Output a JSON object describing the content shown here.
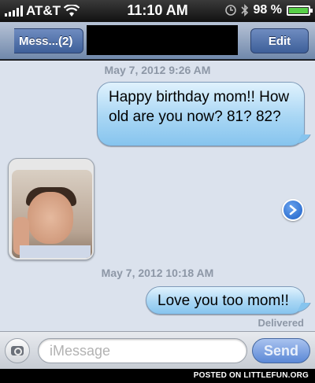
{
  "status_bar": {
    "carrier": "AT&T",
    "time": "11:10 AM",
    "battery_percent": "98 %",
    "battery_level": 0.98
  },
  "nav": {
    "back_label": "Mess...(2)",
    "edit_label": "Edit"
  },
  "messages": [
    {
      "type": "timestamp",
      "text": "May 7, 2012 9:26 AM"
    },
    {
      "type": "sent",
      "text": "Happy birthday mom!! How old are you now? 81? 82?"
    },
    {
      "type": "received_photo"
    },
    {
      "type": "timestamp",
      "text": "May 7, 2012 10:18 AM"
    },
    {
      "type": "sent",
      "text": "Love you too mom!!"
    }
  ],
  "delivered_label": "Delivered",
  "input": {
    "placeholder": "iMessage",
    "send_label": "Send"
  },
  "watermark": "POSTED ON LITTLEFUN.ORG",
  "colors": {
    "sent_bubble": "#a8d6f4",
    "background": "#dbe2ed",
    "nav_bar": "#7088ab"
  },
  "icons": [
    "wifi-icon",
    "clock-icon",
    "bluetooth-icon",
    "battery-icon",
    "camera-icon",
    "forward-icon"
  ]
}
